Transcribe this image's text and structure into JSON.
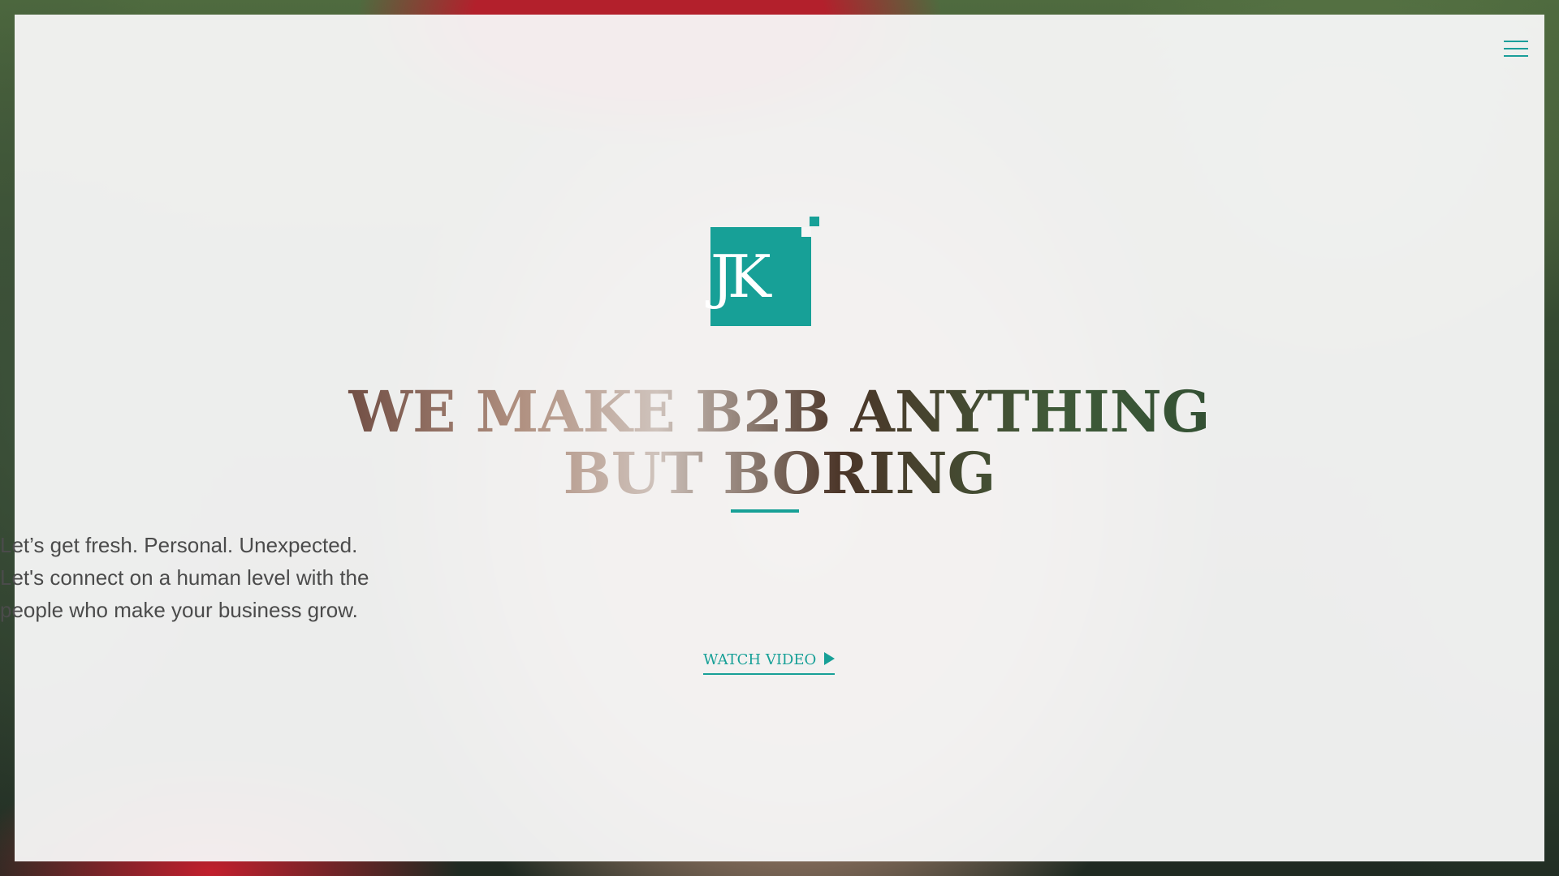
{
  "header": {
    "menu_icon": "hamburger-menu-icon"
  },
  "logo": {
    "text": "JK"
  },
  "hero": {
    "headline_line1": "WE MAKE B2B ANYTHING",
    "headline_line2": "BUT BORING",
    "tagline_line1": "Let’s get fresh. Personal. Unexpected.",
    "tagline_line2": "Let's connect on a human level with the",
    "tagline_line3": "people who make your business grow.",
    "cta_label": "WATCH VIDEO",
    "cta_icon": "play-icon"
  },
  "colors": {
    "accent": "#17a097",
    "text": "#4b4b4b",
    "overlay": "#f6f6f6"
  }
}
